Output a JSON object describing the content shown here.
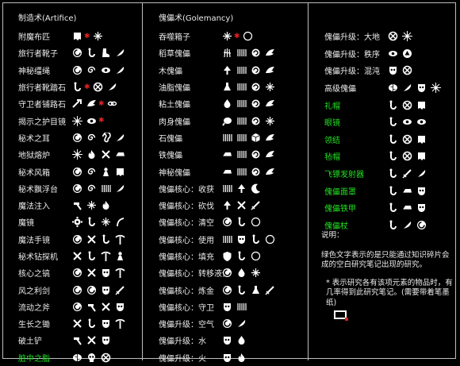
{
  "colors": {
    "green": "#22e022",
    "star": "#e02020",
    "text": "#ececec",
    "bg": "#000000"
  },
  "col1": {
    "header": "制造术(Artifice)",
    "rows": [
      {
        "label": "附魔布匹",
        "green": false,
        "icons": [
          "cloth-icon",
          "star",
          "sparkle-icon"
        ]
      },
      {
        "label": "旅行者靴子",
        "green": false,
        "icons": [
          "swirl-icon",
          "hook-icon",
          "boot-icon",
          "feather-icon"
        ]
      },
      {
        "label": "神秘缰绳",
        "green": false,
        "icons": [
          "swirl-icon",
          "spiral-icon",
          "eye-icon",
          "feather-icon"
        ]
      },
      {
        "label": "旅行者靴踏石",
        "green": false,
        "icons": [
          "hook-icon",
          "star",
          "cross-circle-icon",
          "feather-icon"
        ]
      },
      {
        "label": "守卫者铺路石",
        "green": false,
        "icons": [
          "arrow-icon",
          "wing-icon",
          "star",
          "chain-icon"
        ]
      },
      {
        "label": "揭示之护目镜",
        "green": false,
        "icons": [
          "starburst-icon",
          "eye-icon",
          "star"
        ]
      },
      {
        "label": "秘术之耳",
        "green": false,
        "icons": [
          "swirl-icon",
          "spiral-icon",
          "ear-icon",
          "feather-icon"
        ]
      },
      {
        "label": "地狱熔炉",
        "green": false,
        "icons": [
          "starburst-icon",
          "fire-icon",
          "tools-icon",
          "ingot-icon"
        ]
      },
      {
        "label": "秘术风箱",
        "green": false,
        "icons": [
          "swirl-icon",
          "spiral-icon",
          "pawn-icon",
          "cloth-icon"
        ]
      },
      {
        "label": "秘术飘浮台",
        "green": false,
        "icons": [
          "swirl-icon",
          "spiral-icon",
          "bars-icon",
          "feather-icon"
        ]
      },
      {
        "label": "魔法注入",
        "green": false,
        "icons": [
          "hammer-icon",
          "sparkle-icon",
          "fire-icon"
        ]
      },
      {
        "label": "魔镜",
        "green": false,
        "icons": [
          "gear-icon",
          "hook-icon",
          "sparkle-icon",
          "curve-icon"
        ]
      },
      {
        "label": "魔法手镜",
        "green": false,
        "icons": [
          "swirl-icon",
          "tools-icon",
          "hook-icon",
          "pick-icon"
        ]
      },
      {
        "label": "秘术钻探机",
        "green": false,
        "icons": [
          "tools-icon",
          "hook-icon",
          "pick-icon",
          "pawn-icon"
        ]
      },
      {
        "label": "核心之镐",
        "green": false,
        "icons": [
          "swirl-icon",
          "tools-icon",
          "mask-icon",
          "pick-icon"
        ]
      },
      {
        "label": "风之利剑",
        "green": false,
        "icons": [
          "swirl-icon",
          "swirl-icon",
          "mask-icon",
          "sword-icon"
        ]
      },
      {
        "label": "流动之斧",
        "green": false,
        "icons": [
          "swirl-icon",
          "hammer-icon",
          "tools-icon",
          "mask-icon"
        ]
      },
      {
        "label": "生长之锄",
        "green": false,
        "icons": [
          "tools-icon",
          "hook-icon",
          "mask-icon",
          "pick-icon"
        ]
      },
      {
        "label": "破土铲",
        "green": false,
        "icons": [
          "hammer-icon",
          "tools-icon",
          "mask-icon"
        ]
      },
      {
        "label": "脏中之脂",
        "green": true,
        "icons": [
          "brain-icon",
          "skull-icon",
          "cross-circle-icon"
        ]
      }
    ]
  },
  "col2": {
    "header": "傀儡术(Golemancy)",
    "rows": [
      {
        "label": "吞噬箱子",
        "green": false,
        "icons": [
          "sparkle-icon",
          "star",
          "ring-icon"
        ]
      },
      {
        "label": "稻草傀儡",
        "green": false,
        "icons": [
          "straw-icon",
          "bars-icon",
          "cycle-icon",
          "wing-icon"
        ]
      },
      {
        "label": "木傀儡",
        "green": false,
        "icons": [
          "tree-icon",
          "bars-icon",
          "cycle-icon",
          "wing-icon"
        ]
      },
      {
        "label": "油脂傀儡",
        "green": false,
        "icons": [
          "flask-icon",
          "bars-icon",
          "cycle-icon",
          "sparkle-icon"
        ]
      },
      {
        "label": "粘土傀儡",
        "green": false,
        "icons": [
          "drop-icon",
          "bars-icon",
          "cycle-icon",
          "wing-icon"
        ]
      },
      {
        "label": "肉身傀儡",
        "green": false,
        "icons": [
          "meat-icon",
          "bars-icon",
          "cycle-icon",
          "sparkle-icon"
        ]
      },
      {
        "label": "石傀儡",
        "green": false,
        "icons": [
          "bars-icon",
          "bars-icon",
          "cube-icon",
          "wing-icon"
        ]
      },
      {
        "label": "铁傀儡",
        "green": false,
        "icons": [
          "ingot-icon",
          "bars-icon",
          "cycle-icon",
          "wing-icon"
        ]
      },
      {
        "label": "神秘傀儡",
        "green": false,
        "icons": [
          "ingot-icon",
          "bars-icon",
          "cycle-icon",
          "wing-icon"
        ]
      },
      {
        "label": "傀儡核心：收获",
        "green": false,
        "icons": [
          "bars-icon",
          "tree-icon",
          "moon-icon"
        ]
      },
      {
        "label": "傀儡核心：砍伐",
        "green": false,
        "icons": [
          "tree-icon",
          "tools-icon",
          "sword-icon"
        ]
      },
      {
        "label": "傀儡核心：清空",
        "green": false,
        "icons": [
          "swirl-icon",
          "hook-icon",
          "ring-icon"
        ]
      },
      {
        "label": "傀儡核心：使用",
        "green": false,
        "icons": [
          "bars-icon",
          "mask-icon",
          "hook-icon",
          "ring-icon"
        ]
      },
      {
        "label": "傀儡核心：填充",
        "green": false,
        "icons": [
          "shield-icon",
          "hook-icon",
          "ring-icon"
        ]
      },
      {
        "label": "傀儡核心：转移液体",
        "green": false,
        "icons": [
          "swirl-icon",
          "drop-icon",
          "sparkle-icon"
        ]
      },
      {
        "label": "傀儡核心：炼金",
        "green": false,
        "icons": [
          "swirl-icon",
          "hook-icon",
          "flask-icon",
          "sword-icon"
        ]
      },
      {
        "label": "傀儡核心：守卫",
        "green": false,
        "icons": [
          "mask-icon",
          "bars-icon"
        ]
      },
      {
        "label": "傀儡升级：空气",
        "green": false,
        "icons": [
          "swirl-icon",
          "feather-icon"
        ]
      },
      {
        "label": "傀儡升级：水",
        "green": false,
        "icons": [
          "mask-icon",
          "drop-icon"
        ]
      },
      {
        "label": "傀儡升级：火",
        "green": false,
        "icons": [
          "mask-icon",
          "fire-icon"
        ]
      }
    ]
  },
  "col3": {
    "rows": [
      {
        "label": "傀儡升级：大地",
        "green": false,
        "icons": [
          "cross-circle-icon",
          "starburst-icon"
        ]
      },
      {
        "label": "傀儡升级：秩序",
        "green": false,
        "icons": [
          "eye-icon",
          "triangle-icon"
        ]
      },
      {
        "label": "傀儡升级：混沌",
        "green": false,
        "icons": [
          "mask-icon",
          "cross-circle-icon"
        ]
      },
      {
        "label": "高级傀儡",
        "green": false,
        "icons": [
          "brain-icon",
          "feather-icon",
          "mask-icon",
          "starburst-icon"
        ]
      },
      {
        "label": "礼帽",
        "green": true,
        "icons": [
          "hook-icon",
          "cross-circle-icon",
          "cloth-icon"
        ]
      },
      {
        "label": "眼镜",
        "green": true,
        "icons": [
          "hook-icon",
          "eye-icon",
          "eye-icon"
        ]
      },
      {
        "label": "领结",
        "green": true,
        "icons": [
          "hook-icon",
          "cross-circle-icon",
          "cloth-icon"
        ]
      },
      {
        "label": "毡帽",
        "green": true,
        "icons": [
          "hook-icon",
          "cross-circle-icon",
          "cloth-icon"
        ]
      },
      {
        "label": "飞镖发射器",
        "green": true,
        "icons": [
          "hook-icon",
          "sword-icon",
          "feather-icon"
        ]
      },
      {
        "label": "傀儡面罩",
        "green": true,
        "icons": [
          "hook-icon",
          "ingot-icon",
          "mask-icon"
        ]
      },
      {
        "label": "傀儡铁甲",
        "green": true,
        "icons": [
          "hook-icon",
          "ingot-icon",
          "mask-icon"
        ]
      },
      {
        "label": "傀儡杖",
        "green": true,
        "icons": [
          "hook-icon",
          "feather-icon",
          "swirl-icon"
        ]
      }
    ],
    "notes": {
      "title": "说明：",
      "line1": "绿色文字表示的是只能通过知识碎片会成的空白研究笔记出现的研究。",
      "line2": "* 表示研究各有该项元素的物品时，有几率得到此研究笔记。(需要带着笔墨纸)"
    }
  }
}
